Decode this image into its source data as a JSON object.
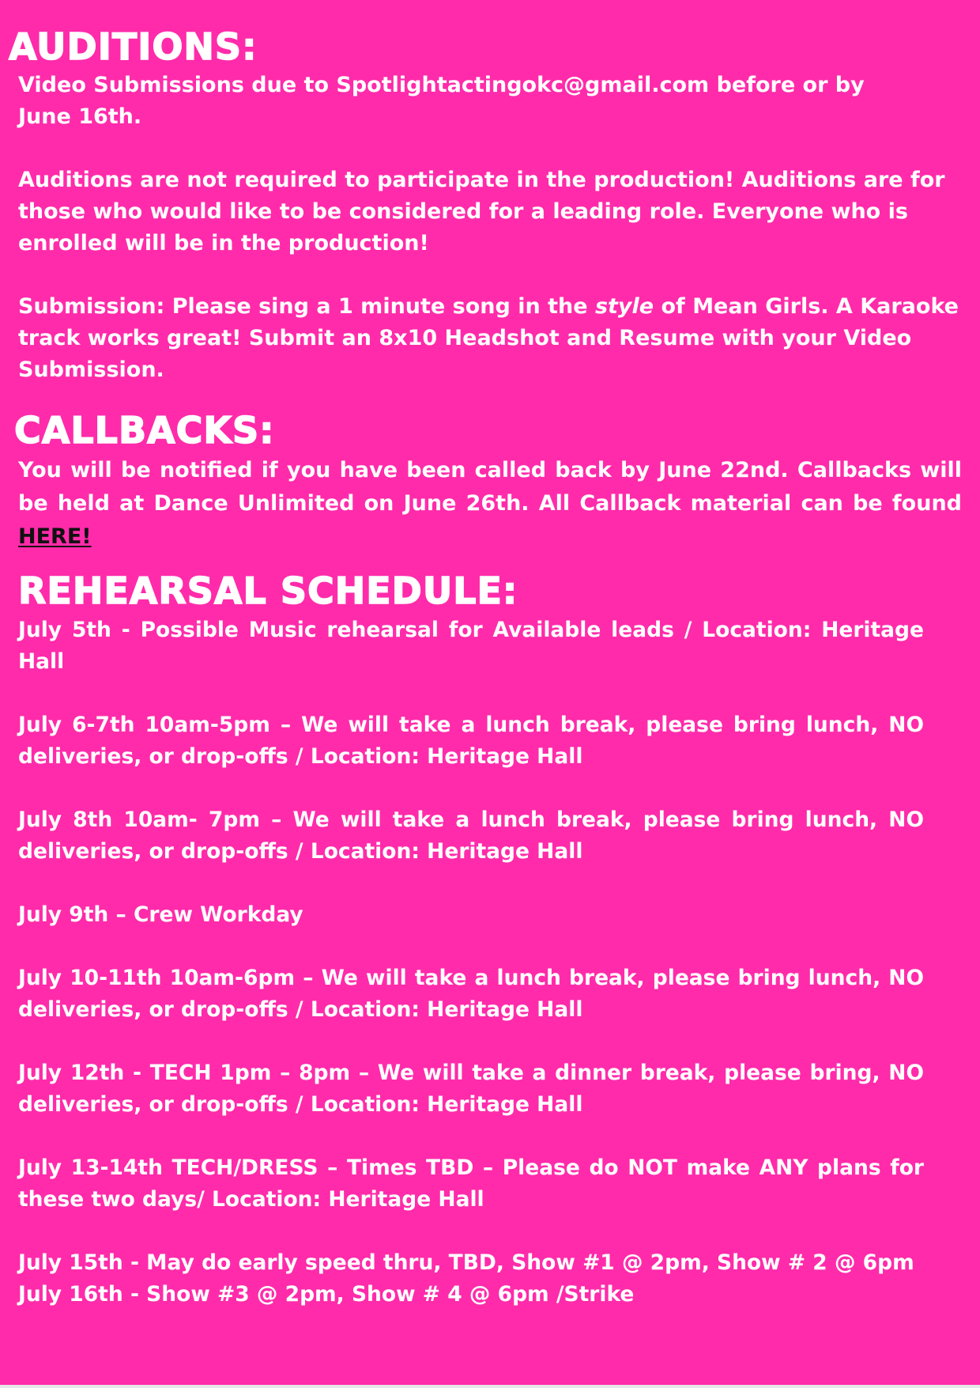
{
  "colors": {
    "background": "#FF2BAA",
    "text": "#FFFFFF",
    "link": "#111111"
  },
  "auditions": {
    "heading": "AUDITIONS:",
    "line1": "Video Submissions due to Spotlightactingokc@gmail.com before or  by June 16th.",
    "para2": "Auditions are not required to participate in the production! Auditions are for those who would like to be considered for a leading role. Everyone who is enrolled will be in the production!",
    "submission_before_style": "Submission: Please sing a 1 minute song in the ",
    "submission_style": "style",
    "submission_after_style": " of Mean Girls. A Karaoke track works great!  Submit an 8x10 Headshot and Resume with your Video Submission."
  },
  "callbacks": {
    "heading": "CALLBACKS:",
    "text": "You will be notified if you have been called back by June 22nd. Callbacks will be held  at Dance Unlimited on June 26th. All Callback material can be found ",
    "link_label": "HERE!"
  },
  "rehearsal": {
    "heading": "REHEARSAL SCHEDULE:",
    "items": [
      "July 5th - Possible Music rehearsal for Available leads / Location: Heritage Hall",
      "July 6-7th 10am-5pm – We will take a lunch break, please bring lunch, NO deliveries, or drop-offs / Location: Heritage Hall",
      "July 8th 10am- 7pm – We will take a lunch break, please bring lunch, NO deliveries, or drop-offs / Location: Heritage Hall",
      "July 9th – Crew Workday",
      "July 10-11th 10am-6pm – We will take a lunch break, please bring lunch, NO deliveries, or drop-offs / Location: Heritage Hall",
      "July 12th - TECH 1pm – 8pm – We will take a dinner break, please bring, NO deliveries, or drop-offs / Location: Heritage Hall",
      "July 13-14th TECH/DRESS – Times TBD – Please do NOT make ANY plans for these two days/ Location: Heritage Hall"
    ],
    "show_lines": [
      "July 15th - May do early speed thru, TBD, Show #1 @ 2pm, Show # 2 @ 6pm",
      "July 16th - Show #3 @ 2pm, Show # 4 @ 6pm /Strike"
    ]
  }
}
